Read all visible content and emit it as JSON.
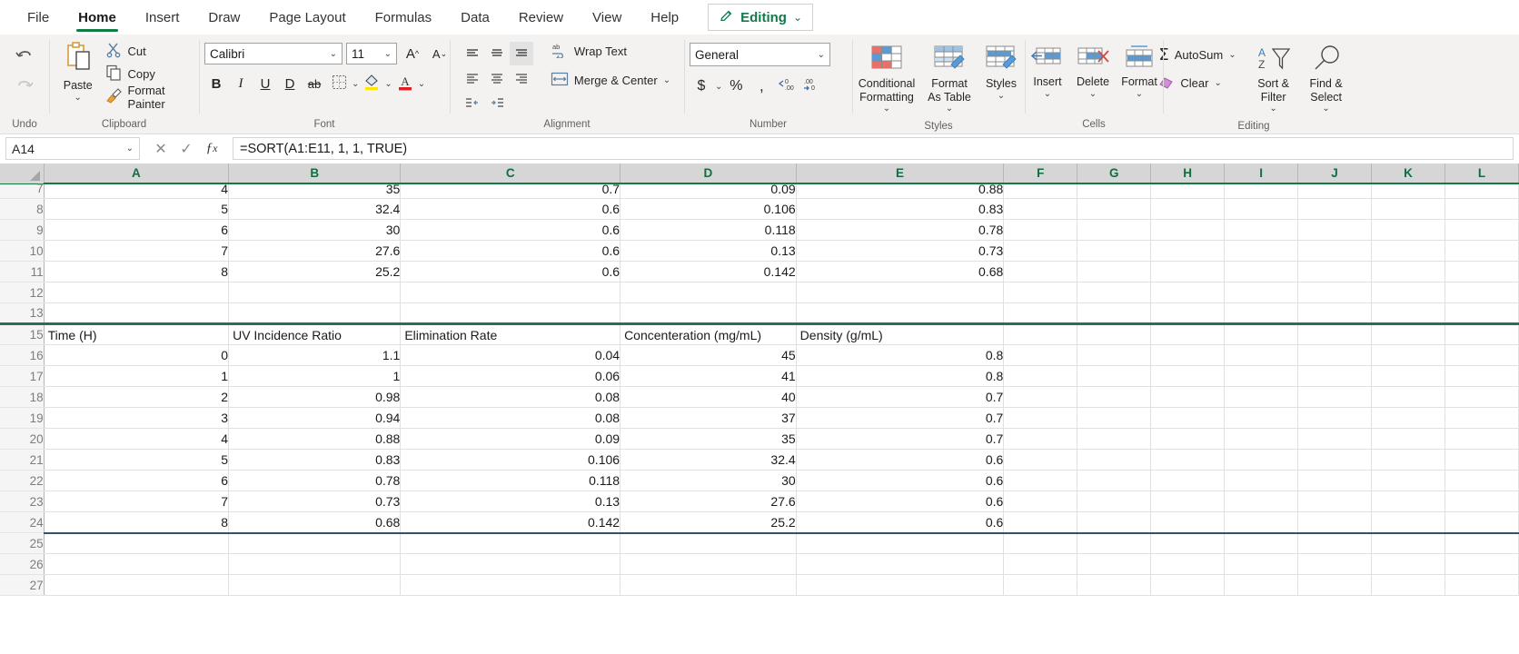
{
  "app": {
    "accent_green": "#107c41",
    "selection_border": "#2c6e4f",
    "spill_border": "#31506b"
  },
  "tabs": [
    {
      "label": "File",
      "active": false
    },
    {
      "label": "Home",
      "active": true
    },
    {
      "label": "Insert",
      "active": false
    },
    {
      "label": "Draw",
      "active": false
    },
    {
      "label": "Page Layout",
      "active": false
    },
    {
      "label": "Formulas",
      "active": false
    },
    {
      "label": "Data",
      "active": false
    },
    {
      "label": "Review",
      "active": false
    },
    {
      "label": "View",
      "active": false
    },
    {
      "label": "Help",
      "active": false
    }
  ],
  "editing_button": {
    "label": "Editing",
    "icon": "pencil-icon",
    "chevron": "⌄"
  },
  "ribbon": {
    "undo": {
      "group_label": "Undo",
      "undo_icon": "undo-arrow-icon",
      "redo_icon": "redo-arrow-icon"
    },
    "clipboard": {
      "group_label": "Clipboard",
      "paste_label": "Paste",
      "cut_label": "Cut",
      "copy_label": "Copy",
      "format_painter_label": "Format Painter"
    },
    "font": {
      "group_label": "Font",
      "font_name": "Calibri",
      "font_size": "11",
      "bold": "B",
      "italic": "I",
      "underline": "U",
      "double_underline": "D",
      "strikethrough": "ab",
      "borders_icon": "borders-icon",
      "fill_icon": "fill-color-icon",
      "font_color_icon": "font-color-icon",
      "grow_font": "A",
      "shrink_font": "A"
    },
    "alignment": {
      "group_label": "Alignment",
      "wrap_text_label": "Wrap Text",
      "merge_center_label": "Merge & Center"
    },
    "number": {
      "group_label": "Number",
      "format": "General",
      "currency_icon": "currency-icon",
      "percent_icon": "percent-icon",
      "comma_icon": "comma-style-icon",
      "increase_decimal_icon": "increase-decimal-icon",
      "decrease_decimal_icon": "decrease-decimal-icon"
    },
    "styles": {
      "group_label": "Styles",
      "conditional_formatting": "Conditional Formatting",
      "format_as_table": "Format As Table",
      "cell_styles": "Styles"
    },
    "cells": {
      "group_label": "Cells",
      "insert": "Insert",
      "delete": "Delete",
      "format": "Format"
    },
    "editing": {
      "group_label": "Editing",
      "autosum": "AutoSum",
      "clear": "Clear",
      "sort_filter": "Sort & Filter",
      "find_select": "Find & Select"
    }
  },
  "formula_bar": {
    "name_box": "A14",
    "cancel_icon": "cancel-x-icon",
    "enter_icon": "confirm-check-icon",
    "fx_label": "fx",
    "formula": "=SORT(A1:E11, 1, 1, TRUE)"
  },
  "sheet": {
    "columns": [
      "A",
      "B",
      "C",
      "D",
      "E",
      "F",
      "G",
      "H",
      "I",
      "J",
      "K",
      "L"
    ],
    "rows": [
      {
        "num": "7",
        "clipped": true,
        "cells": [
          "4",
          "35",
          "0.7",
          "0.09",
          "0.88"
        ],
        "align": "num"
      },
      {
        "num": "8",
        "cells": [
          "5",
          "32.4",
          "0.6",
          "0.106",
          "0.83"
        ],
        "align": "num"
      },
      {
        "num": "9",
        "cells": [
          "6",
          "30",
          "0.6",
          "0.118",
          "0.78"
        ],
        "align": "num"
      },
      {
        "num": "10",
        "cells": [
          "7",
          "27.6",
          "0.6",
          "0.13",
          "0.73"
        ],
        "align": "num"
      },
      {
        "num": "11",
        "cells": [
          "8",
          "25.2",
          "0.6",
          "0.142",
          "0.68"
        ],
        "align": "num"
      },
      {
        "num": "12",
        "cells": [
          "",
          "",
          "",
          "",
          ""
        ],
        "align": "num"
      },
      {
        "num": "13",
        "cells": [
          "",
          "",
          "",
          "",
          ""
        ],
        "align": "num"
      },
      {
        "num": "15",
        "sel_top": true,
        "header": true,
        "cells": [
          "Time (H)",
          "UV Incidence Ratio",
          "Elimination Rate",
          "Concenteration (mg/mL)",
          "Density (g/mL)"
        ],
        "align": "txt"
      },
      {
        "num": "16",
        "cells": [
          "0",
          "1.1",
          "0.04",
          "45",
          "0.8"
        ],
        "align": "num"
      },
      {
        "num": "17",
        "cells": [
          "1",
          "1",
          "0.06",
          "41",
          "0.8"
        ],
        "align": "num"
      },
      {
        "num": "18",
        "cells": [
          "2",
          "0.98",
          "0.08",
          "40",
          "0.7"
        ],
        "align": "num"
      },
      {
        "num": "19",
        "cells": [
          "3",
          "0.94",
          "0.08",
          "37",
          "0.7"
        ],
        "align": "num"
      },
      {
        "num": "20",
        "cells": [
          "4",
          "0.88",
          "0.09",
          "35",
          "0.7"
        ],
        "align": "num"
      },
      {
        "num": "21",
        "cells": [
          "5",
          "0.83",
          "0.106",
          "32.4",
          "0.6"
        ],
        "align": "num"
      },
      {
        "num": "22",
        "cells": [
          "6",
          "0.78",
          "0.118",
          "30",
          "0.6"
        ],
        "align": "num"
      },
      {
        "num": "23",
        "cells": [
          "7",
          "0.73",
          "0.13",
          "27.6",
          "0.6"
        ],
        "align": "num"
      },
      {
        "num": "24",
        "sel_bottom": true,
        "cells": [
          "8",
          "0.68",
          "0.142",
          "25.2",
          "0.6"
        ],
        "align": "num"
      },
      {
        "num": "25",
        "cells": [
          "",
          "",
          "",
          "",
          ""
        ],
        "align": "num"
      },
      {
        "num": "26",
        "cells": [
          "",
          "",
          "",
          "",
          ""
        ],
        "align": "num"
      },
      {
        "num": "27",
        "cells": [
          "",
          "",
          "",
          "",
          ""
        ],
        "align": "num"
      }
    ]
  }
}
